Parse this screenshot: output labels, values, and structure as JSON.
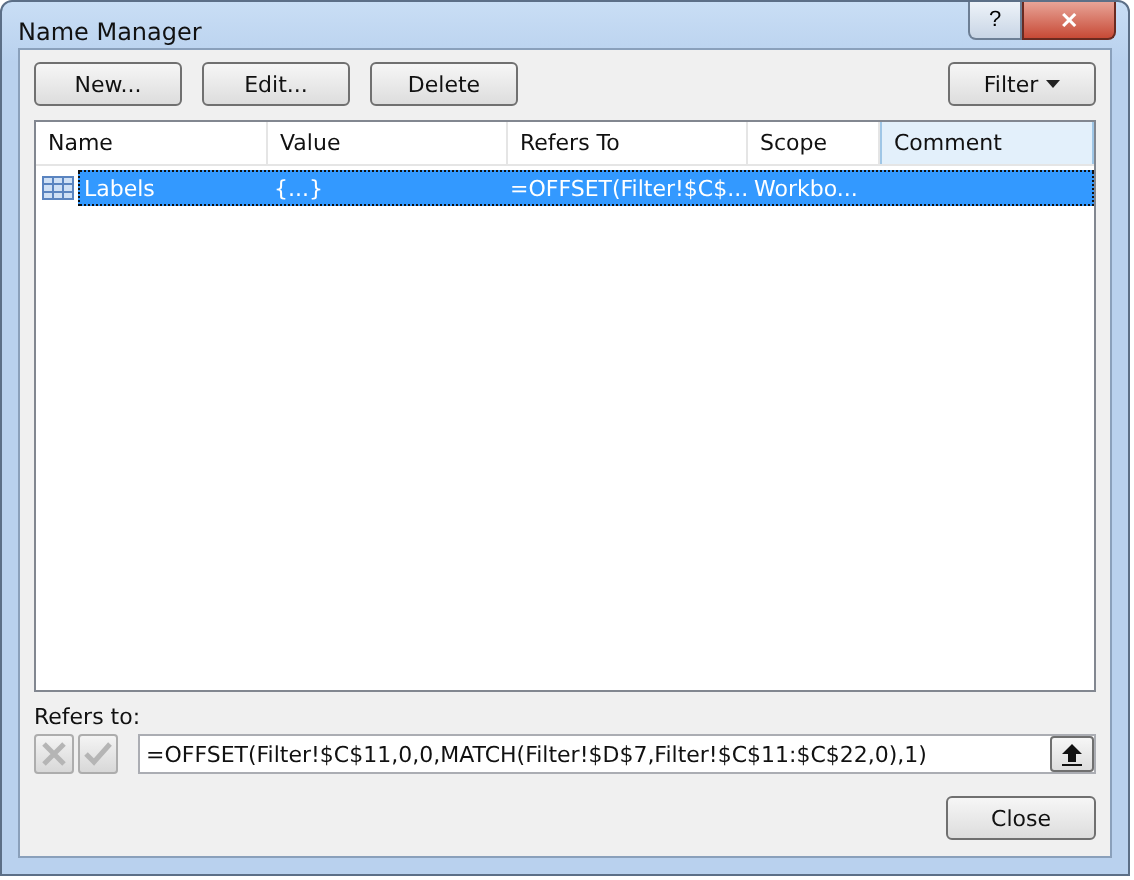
{
  "window": {
    "title": "Name Manager",
    "buttons": [
      "?",
      "✕"
    ]
  },
  "toolbar": {
    "buttons": [
      "New...",
      "Edit...",
      "Delete"
    ],
    "filter": "Filter"
  },
  "table": {
    "columns": [
      {
        "label": "Name",
        "highlighted": false
      },
      {
        "label": "Value",
        "highlighted": false
      },
      {
        "label": "Refers To",
        "highlighted": false
      },
      {
        "label": "Scope",
        "highlighted": false
      },
      {
        "label": "Comment",
        "highlighted": true
      }
    ],
    "rows": [
      {
        "name": "Labels",
        "value": "{...}",
        "refers_to": "=OFFSET(Filter!$C$...",
        "scope": "Workbo...",
        "selected": true
      }
    ]
  },
  "refers_to": {
    "label": "Refers to:",
    "cancel_disabled": true,
    "confirm_disabled": true,
    "value": "=OFFSET(Filter!$C$11,0,0,MATCH(Filter!$D$7,Filter!$C$11:$C$22,0),1)"
  },
  "footer": {
    "close": "Close"
  }
}
